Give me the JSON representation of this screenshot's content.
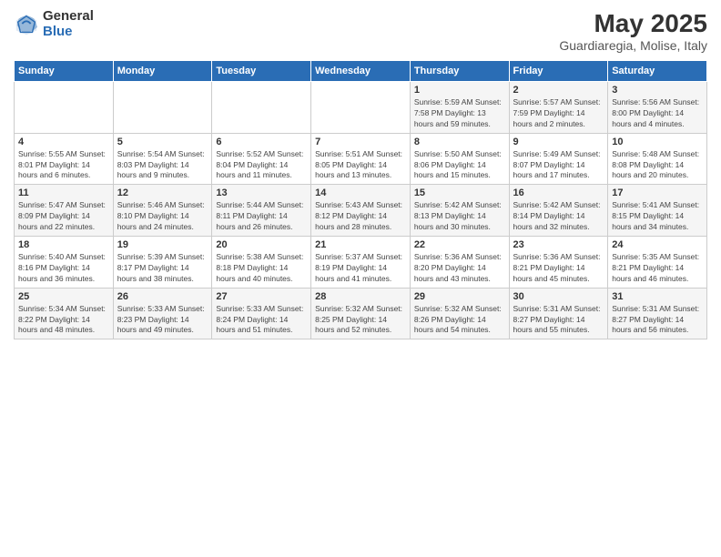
{
  "header": {
    "logo_general": "General",
    "logo_blue": "Blue",
    "title": "May 2025",
    "subtitle": "Guardiaregia, Molise, Italy"
  },
  "days_of_week": [
    "Sunday",
    "Monday",
    "Tuesday",
    "Wednesday",
    "Thursday",
    "Friday",
    "Saturday"
  ],
  "weeks": [
    [
      {
        "day": "",
        "detail": ""
      },
      {
        "day": "",
        "detail": ""
      },
      {
        "day": "",
        "detail": ""
      },
      {
        "day": "",
        "detail": ""
      },
      {
        "day": "1",
        "detail": "Sunrise: 5:59 AM\nSunset: 7:58 PM\nDaylight: 13 hours\nand 59 minutes."
      },
      {
        "day": "2",
        "detail": "Sunrise: 5:57 AM\nSunset: 7:59 PM\nDaylight: 14 hours\nand 2 minutes."
      },
      {
        "day": "3",
        "detail": "Sunrise: 5:56 AM\nSunset: 8:00 PM\nDaylight: 14 hours\nand 4 minutes."
      }
    ],
    [
      {
        "day": "4",
        "detail": "Sunrise: 5:55 AM\nSunset: 8:01 PM\nDaylight: 14 hours\nand 6 minutes."
      },
      {
        "day": "5",
        "detail": "Sunrise: 5:54 AM\nSunset: 8:03 PM\nDaylight: 14 hours\nand 9 minutes."
      },
      {
        "day": "6",
        "detail": "Sunrise: 5:52 AM\nSunset: 8:04 PM\nDaylight: 14 hours\nand 11 minutes."
      },
      {
        "day": "7",
        "detail": "Sunrise: 5:51 AM\nSunset: 8:05 PM\nDaylight: 14 hours\nand 13 minutes."
      },
      {
        "day": "8",
        "detail": "Sunrise: 5:50 AM\nSunset: 8:06 PM\nDaylight: 14 hours\nand 15 minutes."
      },
      {
        "day": "9",
        "detail": "Sunrise: 5:49 AM\nSunset: 8:07 PM\nDaylight: 14 hours\nand 17 minutes."
      },
      {
        "day": "10",
        "detail": "Sunrise: 5:48 AM\nSunset: 8:08 PM\nDaylight: 14 hours\nand 20 minutes."
      }
    ],
    [
      {
        "day": "11",
        "detail": "Sunrise: 5:47 AM\nSunset: 8:09 PM\nDaylight: 14 hours\nand 22 minutes."
      },
      {
        "day": "12",
        "detail": "Sunrise: 5:46 AM\nSunset: 8:10 PM\nDaylight: 14 hours\nand 24 minutes."
      },
      {
        "day": "13",
        "detail": "Sunrise: 5:44 AM\nSunset: 8:11 PM\nDaylight: 14 hours\nand 26 minutes."
      },
      {
        "day": "14",
        "detail": "Sunrise: 5:43 AM\nSunset: 8:12 PM\nDaylight: 14 hours\nand 28 minutes."
      },
      {
        "day": "15",
        "detail": "Sunrise: 5:42 AM\nSunset: 8:13 PM\nDaylight: 14 hours\nand 30 minutes."
      },
      {
        "day": "16",
        "detail": "Sunrise: 5:42 AM\nSunset: 8:14 PM\nDaylight: 14 hours\nand 32 minutes."
      },
      {
        "day": "17",
        "detail": "Sunrise: 5:41 AM\nSunset: 8:15 PM\nDaylight: 14 hours\nand 34 minutes."
      }
    ],
    [
      {
        "day": "18",
        "detail": "Sunrise: 5:40 AM\nSunset: 8:16 PM\nDaylight: 14 hours\nand 36 minutes."
      },
      {
        "day": "19",
        "detail": "Sunrise: 5:39 AM\nSunset: 8:17 PM\nDaylight: 14 hours\nand 38 minutes."
      },
      {
        "day": "20",
        "detail": "Sunrise: 5:38 AM\nSunset: 8:18 PM\nDaylight: 14 hours\nand 40 minutes."
      },
      {
        "day": "21",
        "detail": "Sunrise: 5:37 AM\nSunset: 8:19 PM\nDaylight: 14 hours\nand 41 minutes."
      },
      {
        "day": "22",
        "detail": "Sunrise: 5:36 AM\nSunset: 8:20 PM\nDaylight: 14 hours\nand 43 minutes."
      },
      {
        "day": "23",
        "detail": "Sunrise: 5:36 AM\nSunset: 8:21 PM\nDaylight: 14 hours\nand 45 minutes."
      },
      {
        "day": "24",
        "detail": "Sunrise: 5:35 AM\nSunset: 8:21 PM\nDaylight: 14 hours\nand 46 minutes."
      }
    ],
    [
      {
        "day": "25",
        "detail": "Sunrise: 5:34 AM\nSunset: 8:22 PM\nDaylight: 14 hours\nand 48 minutes."
      },
      {
        "day": "26",
        "detail": "Sunrise: 5:33 AM\nSunset: 8:23 PM\nDaylight: 14 hours\nand 49 minutes."
      },
      {
        "day": "27",
        "detail": "Sunrise: 5:33 AM\nSunset: 8:24 PM\nDaylight: 14 hours\nand 51 minutes."
      },
      {
        "day": "28",
        "detail": "Sunrise: 5:32 AM\nSunset: 8:25 PM\nDaylight: 14 hours\nand 52 minutes."
      },
      {
        "day": "29",
        "detail": "Sunrise: 5:32 AM\nSunset: 8:26 PM\nDaylight: 14 hours\nand 54 minutes."
      },
      {
        "day": "30",
        "detail": "Sunrise: 5:31 AM\nSunset: 8:27 PM\nDaylight: 14 hours\nand 55 minutes."
      },
      {
        "day": "31",
        "detail": "Sunrise: 5:31 AM\nSunset: 8:27 PM\nDaylight: 14 hours\nand 56 minutes."
      }
    ]
  ]
}
